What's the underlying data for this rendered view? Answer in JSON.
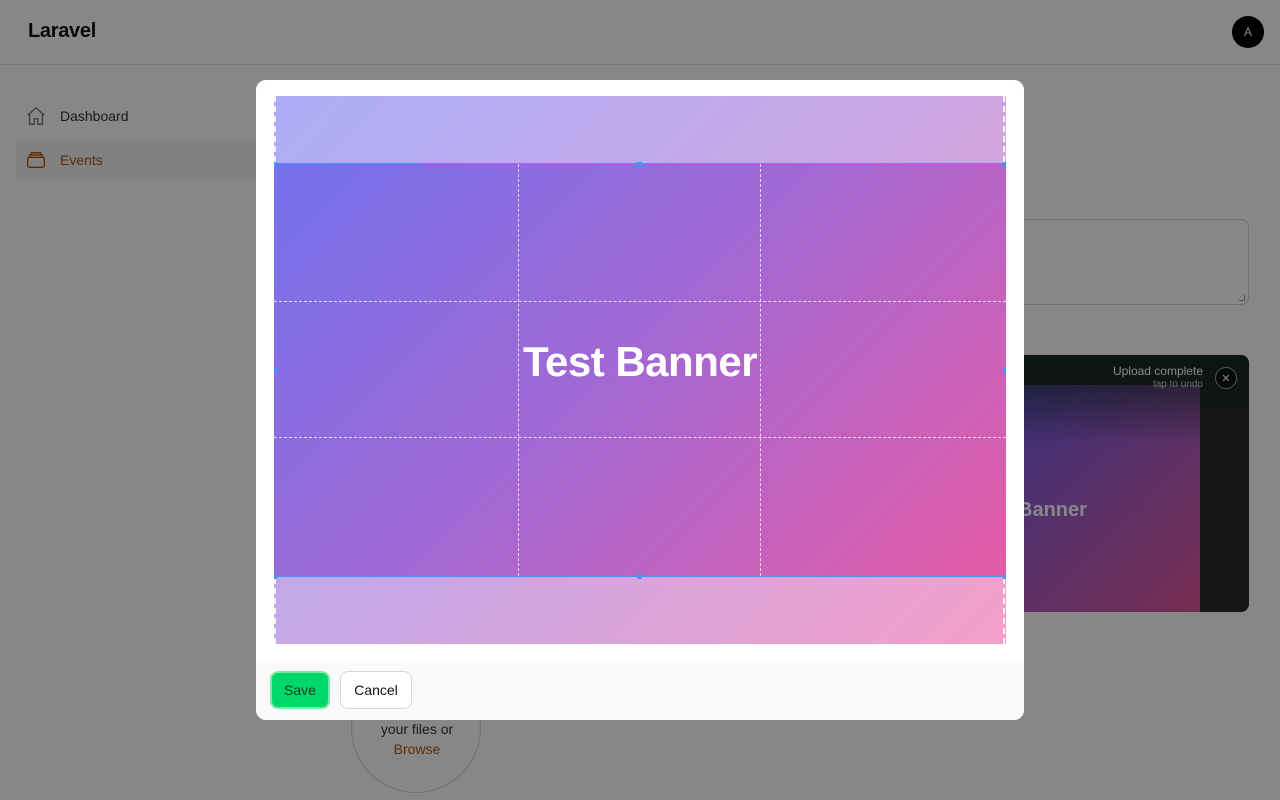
{
  "header": {
    "brand": "Laravel",
    "avatar_initial": "A"
  },
  "sidebar": {
    "items": [
      {
        "label": "Dashboard",
        "icon": "home-icon",
        "active": false
      },
      {
        "label": "Events",
        "icon": "box-icon",
        "active": true
      }
    ]
  },
  "upload_preview": {
    "status": "Upload complete",
    "hint": "tap to undo",
    "image_text": "Banner",
    "close_icon": "close-icon"
  },
  "dropzone": {
    "text": "your files or",
    "browse": "Browse"
  },
  "crop_modal": {
    "image_text": "Test Banner",
    "save_label": "Save",
    "cancel_label": "Cancel"
  },
  "colors": {
    "accent": "#b45309",
    "save_button": "#00d86a",
    "crop_outline": "#4a90ff",
    "gradient_start": "#6f73f0",
    "gradient_end": "#ec5aa2"
  }
}
